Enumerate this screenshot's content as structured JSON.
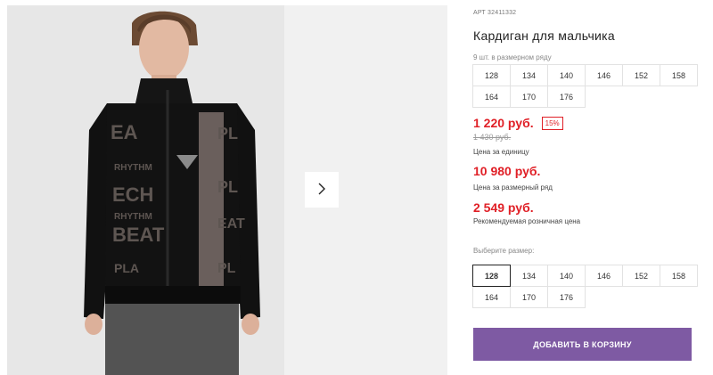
{
  "product": {
    "sku": "АРТ 32411332",
    "title": "Кардиган для мальчика",
    "pack_label": "9 шт. в размерном ряду",
    "pack_sizes": [
      "128",
      "134",
      "140",
      "146",
      "152",
      "158",
      "164",
      "170",
      "176"
    ],
    "price": "1 220 руб.",
    "discount": "15%",
    "old_price": "1 430 руб.",
    "price_caption": "Цена за единицу",
    "pack_price": "10 980 руб.",
    "pack_price_caption": "Цена за размерный ряд",
    "retail_price": "2 549 руб.",
    "retail_price_caption": "Рекомендуемая розничная цена",
    "choose_label": "Выберите размер:",
    "select_sizes": [
      "128",
      "134",
      "140",
      "146",
      "152",
      "158",
      "164",
      "170",
      "176"
    ],
    "selected_size": "128",
    "add_to_cart": "ДОБАВИТЬ В КОРЗИНУ"
  },
  "gallery": {
    "next_icon": "chevron-right-icon"
  },
  "colors": {
    "price_red": "#e01f26",
    "button_purple": "#7e5aa3"
  }
}
